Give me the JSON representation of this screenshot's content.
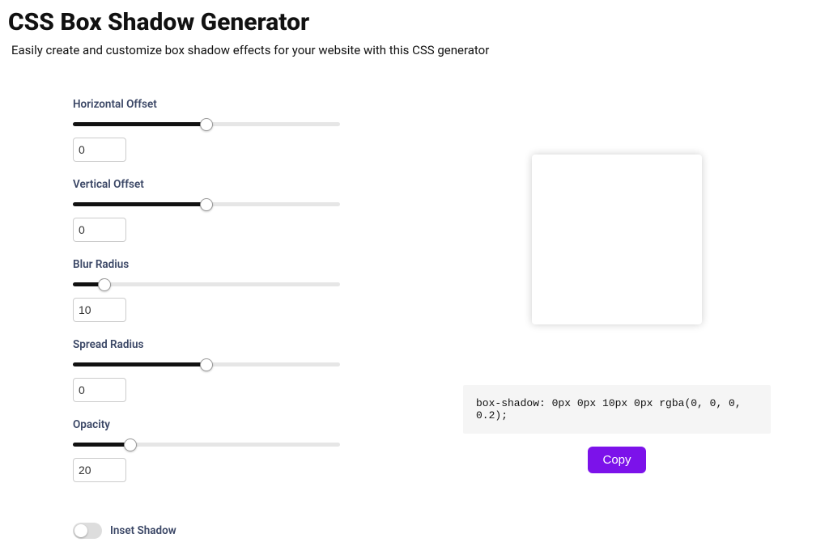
{
  "header": {
    "title": "CSS Box Shadow Generator",
    "subtitle": "Easily create and customize box shadow effects for your website with this CSS generator"
  },
  "controls": {
    "horizontal": {
      "label": "Horizontal Offset",
      "value": "0",
      "min": -100,
      "max": 100,
      "fill": 50
    },
    "vertical": {
      "label": "Vertical Offset",
      "value": "0",
      "min": -100,
      "max": 100,
      "fill": 50
    },
    "blur": {
      "label": "Blur Radius",
      "value": "10",
      "min": 0,
      "max": 100,
      "fill": 10
    },
    "spread": {
      "label": "Spread Radius",
      "value": "0",
      "min": -100,
      "max": 100,
      "fill": 50
    },
    "opacity": {
      "label": "Opacity",
      "value": "20",
      "min": 0,
      "max": 100,
      "fill": 20
    },
    "inset": {
      "label": "Inset Shadow",
      "checked": false
    }
  },
  "output": {
    "css": "box-shadow: 0px 0px 10px 0px rgba(0, 0, 0, 0.2);",
    "copy_label": "Copy"
  }
}
